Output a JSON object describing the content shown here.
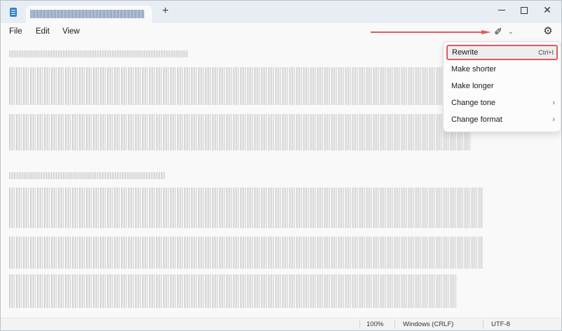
{
  "window": {
    "new_tab_glyph": "+",
    "close_glyph": "✕"
  },
  "menubar": {
    "file": "File",
    "edit": "Edit",
    "view": "View"
  },
  "toolbar": {
    "copilot_icon": "sparkle-pen-icon",
    "copilot_glyph": "✐",
    "chevron_glyph": "⌄",
    "settings_glyph": "⚙"
  },
  "dropdown": {
    "items": [
      {
        "label": "Rewrite",
        "shortcut": "Ctrl+I",
        "highlighted": true
      },
      {
        "label": "Make shorter"
      },
      {
        "label": "Make longer"
      },
      {
        "label": "Change tone",
        "submenu": "›"
      },
      {
        "label": "Change format",
        "submenu": "›"
      }
    ]
  },
  "statusbar": {
    "zoom": "100%",
    "line_ending": "Windows (CRLF)",
    "encoding": "UTF-8"
  },
  "colors": {
    "highlight_border": "#e05a5f",
    "arrow": "#e05a5f",
    "accent": "#2f7fd6"
  }
}
